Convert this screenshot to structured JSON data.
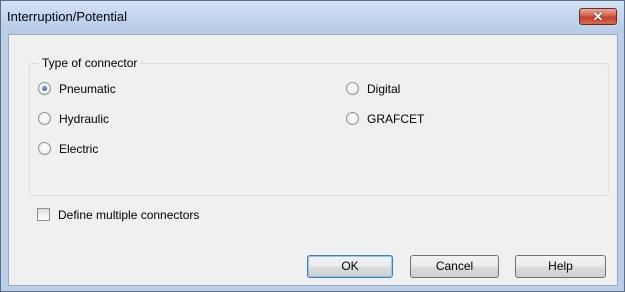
{
  "window": {
    "title": "Interruption/Potential",
    "close_glyph": "✕"
  },
  "connector_group": {
    "title": "Type of connector",
    "options": [
      {
        "label": "Pneumatic",
        "checked": true
      },
      {
        "label": "Hydraulic",
        "checked": false
      },
      {
        "label": "Electric",
        "checked": false
      },
      {
        "label": "Digital",
        "checked": false
      },
      {
        "label": "GRAFCET",
        "checked": false
      }
    ]
  },
  "multiple": {
    "label": "Define multiple connectors",
    "checked": false
  },
  "buttons": {
    "ok": "OK",
    "cancel": "Cancel",
    "help": "Help"
  }
}
